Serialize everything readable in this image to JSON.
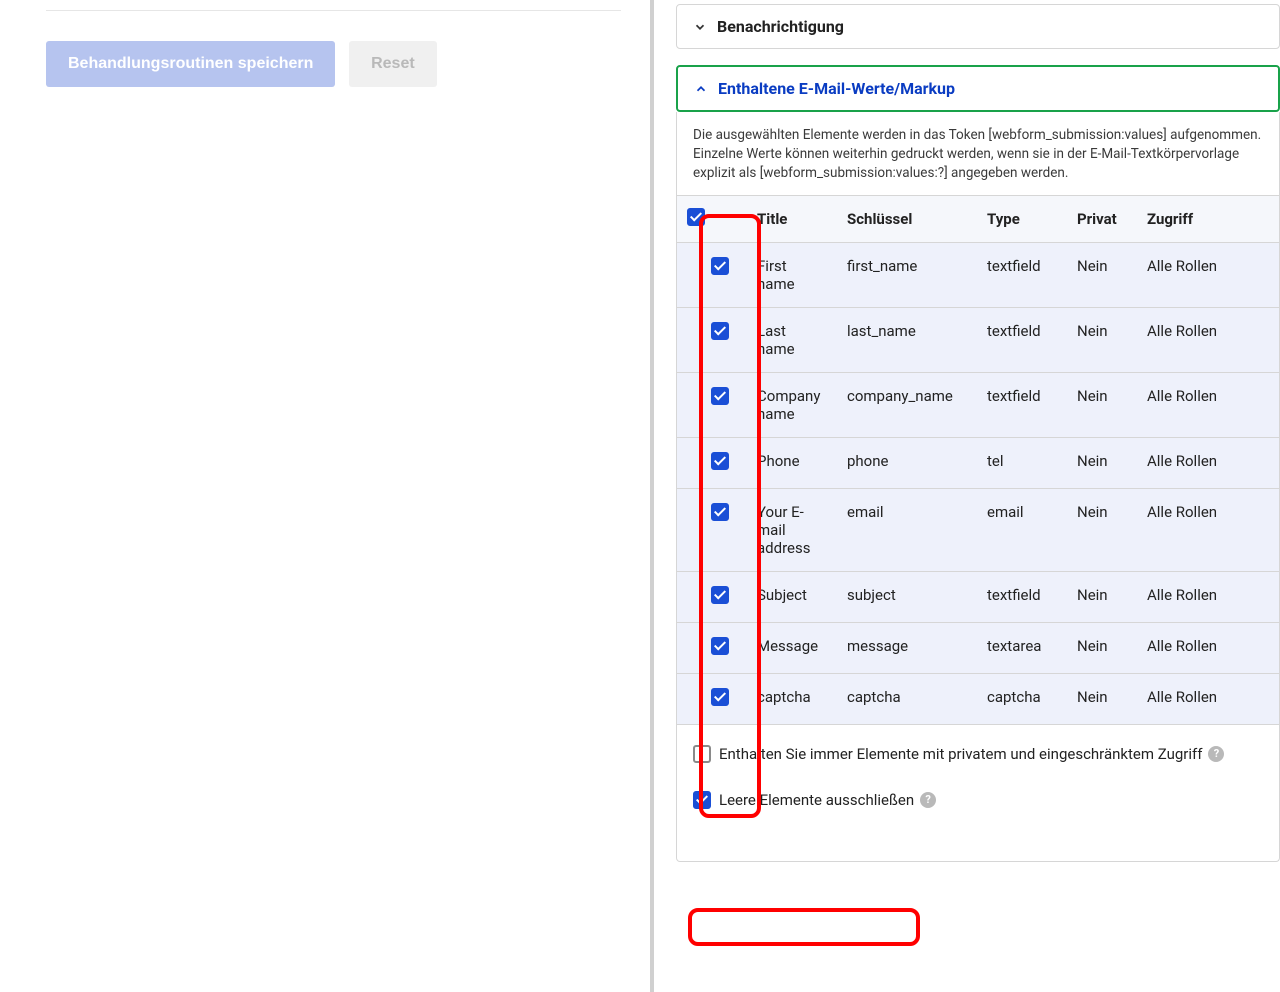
{
  "left": {
    "save_label": "Behandlungsroutinen speichern",
    "reset_label": "Reset"
  },
  "panels": {
    "notification_title": "Benachrichtigung",
    "values_title": "Enthaltene E-Mail-Werte/Markup",
    "values_help": "Die ausgewählten Elemente werden in das Token [webform_submission:values] aufgenommen. Einzelne Werte können weiterhin gedruckt werden, wenn sie in der E-Mail-Textkörpervorlage explizit als [webform_submission:values:?] angegeben werden."
  },
  "table": {
    "headers": {
      "title": "Title",
      "key": "Schlüssel",
      "type": "Type",
      "private": "Privat",
      "access": "Zugriff"
    },
    "rows": [
      {
        "title": "First name",
        "key": "first_name",
        "type": "textfield",
        "private": "Nein",
        "access": "Alle Rollen"
      },
      {
        "title": "Last name",
        "key": "last_name",
        "type": "textfield",
        "private": "Nein",
        "access": "Alle Rollen"
      },
      {
        "title": "Company name",
        "key": "company_name",
        "type": "textfield",
        "private": "Nein",
        "access": "Alle Rollen"
      },
      {
        "title": "Phone",
        "key": "phone",
        "type": "tel",
        "private": "Nein",
        "access": "Alle Rollen"
      },
      {
        "title": "Your E-mail address",
        "key": "email",
        "type": "email",
        "private": "Nein",
        "access": "Alle Rollen"
      },
      {
        "title": "Subject",
        "key": "subject",
        "type": "textfield",
        "private": "Nein",
        "access": "Alle Rollen"
      },
      {
        "title": "Message",
        "key": "message",
        "type": "textarea",
        "private": "Nein",
        "access": "Alle Rollen"
      },
      {
        "title": "captcha",
        "key": "captcha",
        "type": "captcha",
        "private": "Nein",
        "access": "Alle Rollen"
      }
    ]
  },
  "footer": {
    "include_private_label": "Enthalten Sie immer Elemente mit privatem und eingeschränktem Zugriff",
    "exclude_empty_label": "Leere Elemente ausschließen"
  }
}
